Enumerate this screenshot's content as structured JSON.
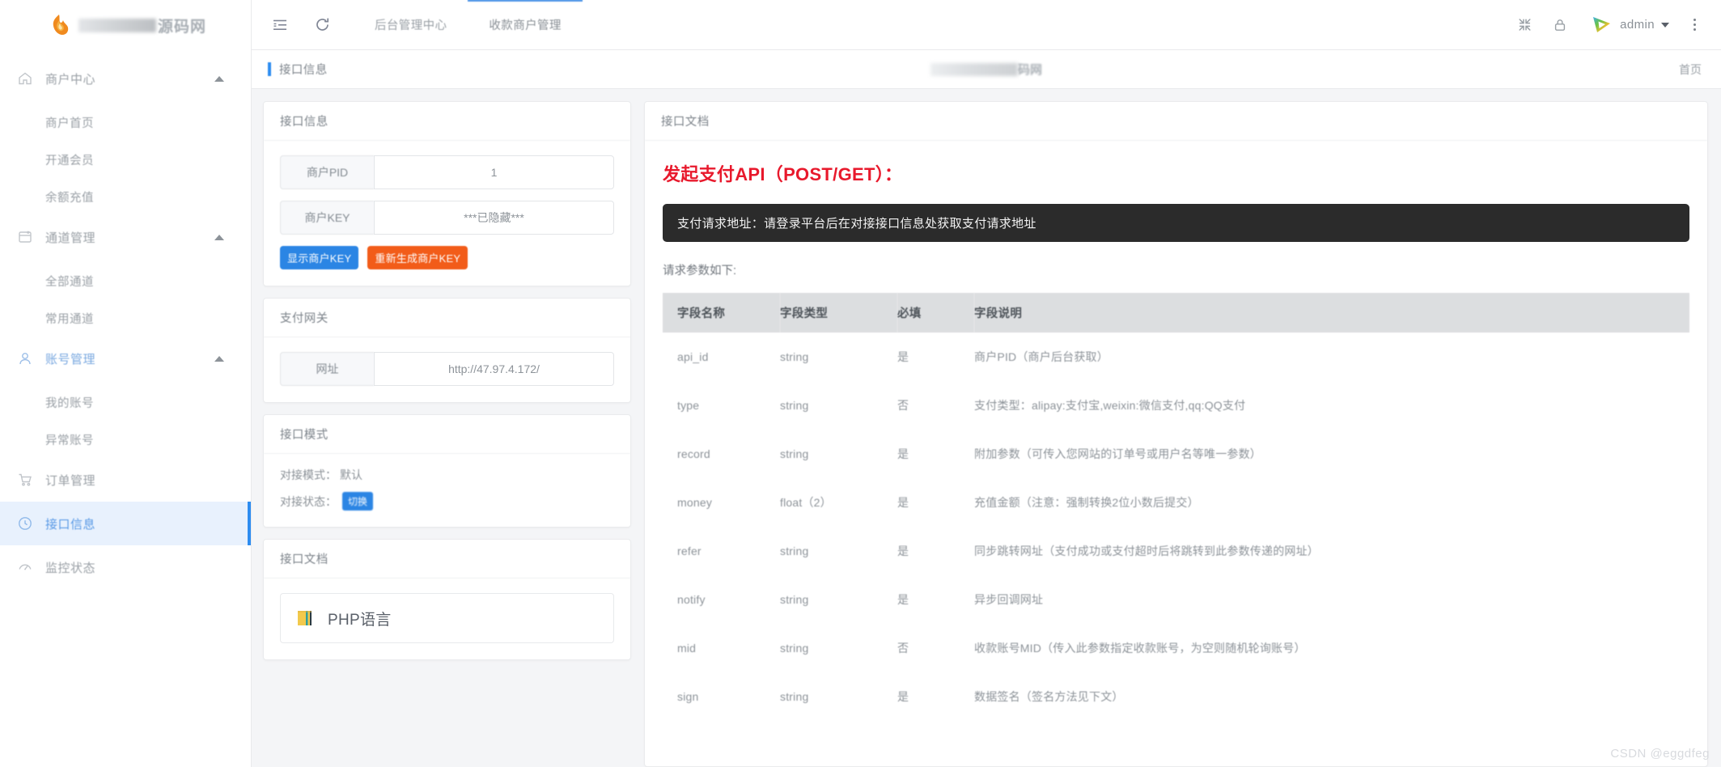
{
  "brand": {
    "logo_suffix": "源码网",
    "logo_censored": true
  },
  "sidebar": {
    "groups": [
      {
        "label": "商户中心",
        "icon": "home-icon",
        "expanded": true,
        "active": false,
        "items": [
          {
            "label": "商户首页"
          },
          {
            "label": "开通会员"
          },
          {
            "label": "余额充值"
          }
        ]
      },
      {
        "label": "通道管理",
        "icon": "channel-icon",
        "expanded": true,
        "active": false,
        "items": [
          {
            "label": "全部通道"
          },
          {
            "label": "常用通道"
          }
        ]
      },
      {
        "label": "账号管理",
        "icon": "user-icon",
        "expanded": true,
        "active": true,
        "items": [
          {
            "label": "我的账号"
          },
          {
            "label": "异常账号"
          }
        ]
      }
    ],
    "single_items": [
      {
        "label": "订单管理",
        "icon": "cart-icon",
        "selected": false
      },
      {
        "label": "接口信息",
        "icon": "clock-icon",
        "selected": true
      },
      {
        "label": "监控状态",
        "icon": "monitor-icon",
        "selected": false
      }
    ]
  },
  "topbar": {
    "collapse_icon": "list-collapse-icon",
    "refresh_icon": "refresh-icon",
    "tabs": [
      {
        "label": "后台管理中心",
        "active": false
      },
      {
        "label": "收款商户管理",
        "active": true
      }
    ],
    "fullscreen_icon": "fullscreen-exit-icon",
    "lock_icon": "lock-icon",
    "avatar_icon": "play-logo-avatar",
    "user": "admin",
    "more_icon": "more-vertical-icon"
  },
  "subbar": {
    "title": "接口信息",
    "center_title_suffix": "码网",
    "right_link": "首页"
  },
  "left": {
    "interface_info": {
      "card_title": "接口信息",
      "fields": [
        {
          "label": "商户PID",
          "value": "1"
        },
        {
          "label": "商户KEY",
          "value": "***已隐藏***"
        }
      ],
      "buttons": [
        {
          "label": "显示商户KEY",
          "style": "blue"
        },
        {
          "label": "重新生成商户KEY",
          "style": "orange"
        }
      ]
    },
    "gateway": {
      "card_title": "支付网关",
      "fields": [
        {
          "label": "网址",
          "value": "http://47.97.4.172/"
        }
      ]
    },
    "mode": {
      "card_title": "接口模式",
      "mode_label": "对接模式：",
      "mode_value": "默认",
      "status_label": "对接状态：",
      "status_button": "切换"
    },
    "docs": {
      "card_title": "接口文档",
      "items": [
        {
          "label": "PHP语言",
          "icon": "php-book-icon"
        }
      ]
    }
  },
  "right": {
    "card_title": "接口文档",
    "api_heading": "发起支付API（POST/GET）：",
    "code_block": "支付请求地址：请登录平台后在对接接口信息处获取支付请求地址",
    "params_label": "请求参数如下:",
    "table": {
      "headers": [
        "字段名称",
        "字段类型",
        "必填",
        "字段说明"
      ],
      "rows": [
        [
          "api_id",
          "string",
          "是",
          "商户PID（商户后台获取）"
        ],
        [
          "type",
          "string",
          "否",
          "支付类型：alipay:支付宝,weixin:微信支付,qq:QQ支付"
        ],
        [
          "record",
          "string",
          "是",
          "附加参数（可传入您网站的订单号或用户名等唯一参数）"
        ],
        [
          "money",
          "float（2）",
          "是",
          "充值金额（注意：强制转换2位小数后提交）"
        ],
        [
          "refer",
          "string",
          "是",
          "同步跳转网址（支付成功或支付超时后将跳转到此参数传递的网址）"
        ],
        [
          "notify",
          "string",
          "是",
          "异步回调网址"
        ],
        [
          "mid",
          "string",
          "否",
          "收款账号MID（传入此参数指定收款账号，为空则随机轮询账号）"
        ],
        [
          "sign",
          "string",
          "是",
          "数据签名（签名方法见下文）"
        ]
      ]
    }
  },
  "watermark": "CSDN @eggdfeg",
  "colors": {
    "accent_blue": "#2d8cf0",
    "button_blue": "#2b85e4",
    "button_orange": "#f25c19",
    "heading_red": "#e8192c",
    "code_bg": "#2b2b2b"
  }
}
